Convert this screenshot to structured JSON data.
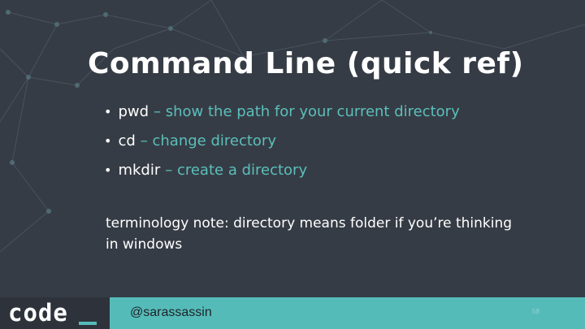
{
  "slide": {
    "title": "Command Line (quick ref)",
    "bullets": [
      {
        "command": "pwd",
        "description": "– show the path for your current directory"
      },
      {
        "command": "cd",
        "description": "– change directory"
      },
      {
        "command": "mkdir",
        "description": "– create a directory"
      }
    ],
    "note": "terminology note: directory means folder if you’re thinking in windows"
  },
  "footer": {
    "logo": "code",
    "handle": "@sarassassin",
    "page_number": "58"
  },
  "colors": {
    "background": "#363c45",
    "accent": "#5bbfbc",
    "footer_bar": "#55bbb8",
    "logo_block": "#2e333b"
  }
}
